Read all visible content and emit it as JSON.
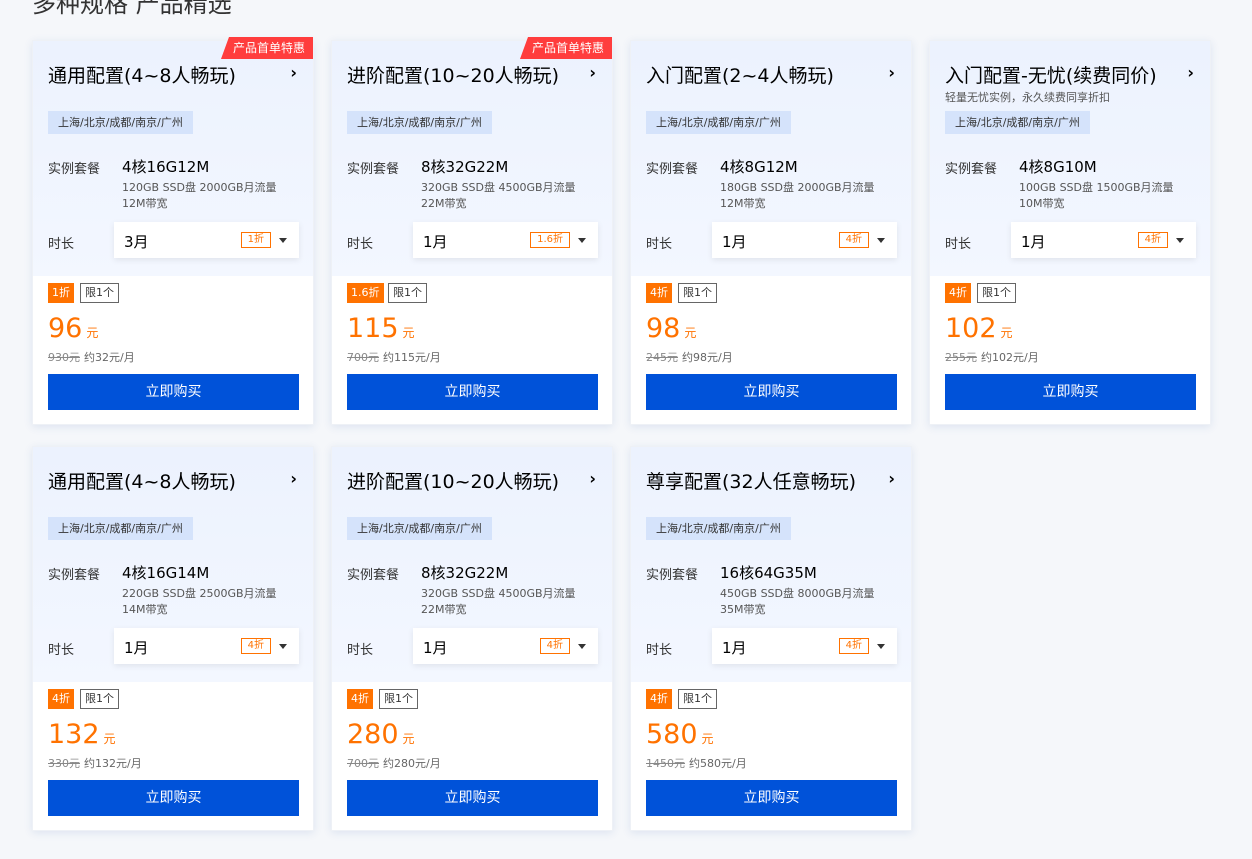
{
  "page": {
    "section_title": "多种规格 产品精选"
  },
  "common": {
    "spec_label": "实例套餐",
    "duration_label": "时长",
    "buy_label": "立即购买",
    "limit_label": "限1个",
    "currency_unit": "元",
    "arrow": "›"
  },
  "cards": [
    {
      "promo": "产品首单特惠",
      "title": "通用配置(4~8人畅玩)",
      "desc": "",
      "region": "上海/北京/成都/南京/广州",
      "spec": "4核16G12M",
      "spec_line1": "120GB SSD盘 2000GB月流量",
      "spec_line2": "12M带宽",
      "duration": "3月",
      "duration_discount": "1折",
      "discount_badge": "1折",
      "price": "96",
      "original_price": "930元",
      "monthly": "约32元/月"
    },
    {
      "promo": "产品首单特惠",
      "title": "进阶配置(10~20人畅玩)",
      "desc": "",
      "region": "上海/北京/成都/南京/广州",
      "spec": "8核32G22M",
      "spec_line1": "320GB SSD盘 4500GB月流量",
      "spec_line2": "22M带宽",
      "duration": "1月",
      "duration_discount": "1.6折",
      "discount_badge": "1.6折",
      "price": "115",
      "original_price": "700元",
      "monthly": "约115元/月"
    },
    {
      "promo": "",
      "title": "入门配置(2~4人畅玩)",
      "desc": "",
      "region": "上海/北京/成都/南京/广州",
      "spec": "4核8G12M",
      "spec_line1": "180GB SSD盘 2000GB月流量",
      "spec_line2": "12M带宽",
      "duration": "1月",
      "duration_discount": "4折",
      "discount_badge": "4折",
      "price": "98",
      "original_price": "245元",
      "monthly": "约98元/月"
    },
    {
      "promo": "",
      "title": "入门配置-无忧(续费同价)",
      "desc": "轻量无忧实例，永久续费同享折扣",
      "region": "上海/北京/成都/南京/广州",
      "spec": "4核8G10M",
      "spec_line1": "100GB SSD盘 1500GB月流量",
      "spec_line2": "10M带宽",
      "duration": "1月",
      "duration_discount": "4折",
      "discount_badge": "4折",
      "price": "102",
      "original_price": "255元",
      "monthly": "约102元/月"
    },
    {
      "promo": "",
      "title": "通用配置(4~8人畅玩)",
      "desc": "",
      "region": "上海/北京/成都/南京/广州",
      "spec": "4核16G14M",
      "spec_line1": "220GB SSD盘 2500GB月流量",
      "spec_line2": "14M带宽",
      "duration": "1月",
      "duration_discount": "4折",
      "discount_badge": "4折",
      "price": "132",
      "original_price": "330元",
      "monthly": "约132元/月"
    },
    {
      "promo": "",
      "title": "进阶配置(10~20人畅玩)",
      "desc": "",
      "region": "上海/北京/成都/南京/广州",
      "spec": "8核32G22M",
      "spec_line1": "320GB SSD盘 4500GB月流量",
      "spec_line2": "22M带宽",
      "duration": "1月",
      "duration_discount": "4折",
      "discount_badge": "4折",
      "price": "280",
      "original_price": "700元",
      "monthly": "约280元/月"
    },
    {
      "promo": "",
      "title": "尊享配置(32人任意畅玩)",
      "desc": "",
      "region": "上海/北京/成都/南京/广州",
      "spec": "16核64G35M",
      "spec_line1": "450GB SSD盘 8000GB月流量",
      "spec_line2": "35M带宽",
      "duration": "1月",
      "duration_discount": "4折",
      "discount_badge": "4折",
      "price": "580",
      "original_price": "1450元",
      "monthly": "约580元/月"
    }
  ],
  "colors": {
    "accent": "#0052d9",
    "price": "#ff7200",
    "promo": "#ff3d3d"
  }
}
